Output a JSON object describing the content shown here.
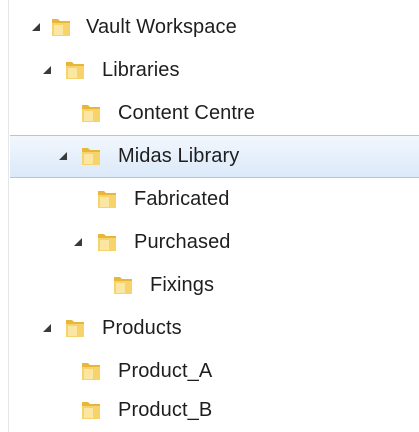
{
  "tree": {
    "nodes": [
      {
        "id": "vault-workspace",
        "label": "Vault Workspace",
        "expanded": true,
        "selected": false
      },
      {
        "id": "libraries",
        "label": "Libraries",
        "expanded": true,
        "selected": false
      },
      {
        "id": "content-centre",
        "label": "Content Centre",
        "expanded": false,
        "selected": false
      },
      {
        "id": "midas-library",
        "label": "Midas Library",
        "expanded": true,
        "selected": true
      },
      {
        "id": "fabricated",
        "label": "Fabricated",
        "expanded": false,
        "selected": false
      },
      {
        "id": "purchased",
        "label": "Purchased",
        "expanded": true,
        "selected": false
      },
      {
        "id": "fixings",
        "label": "Fixings",
        "expanded": false,
        "selected": false
      },
      {
        "id": "products",
        "label": "Products",
        "expanded": true,
        "selected": false
      },
      {
        "id": "product-a",
        "label": "Product_A",
        "expanded": false,
        "selected": false
      },
      {
        "id": "product-b",
        "label": "Product_B",
        "expanded": false,
        "selected": false
      }
    ],
    "folder_color": "#f2c94c",
    "selection_color": "#dbe9f9"
  }
}
